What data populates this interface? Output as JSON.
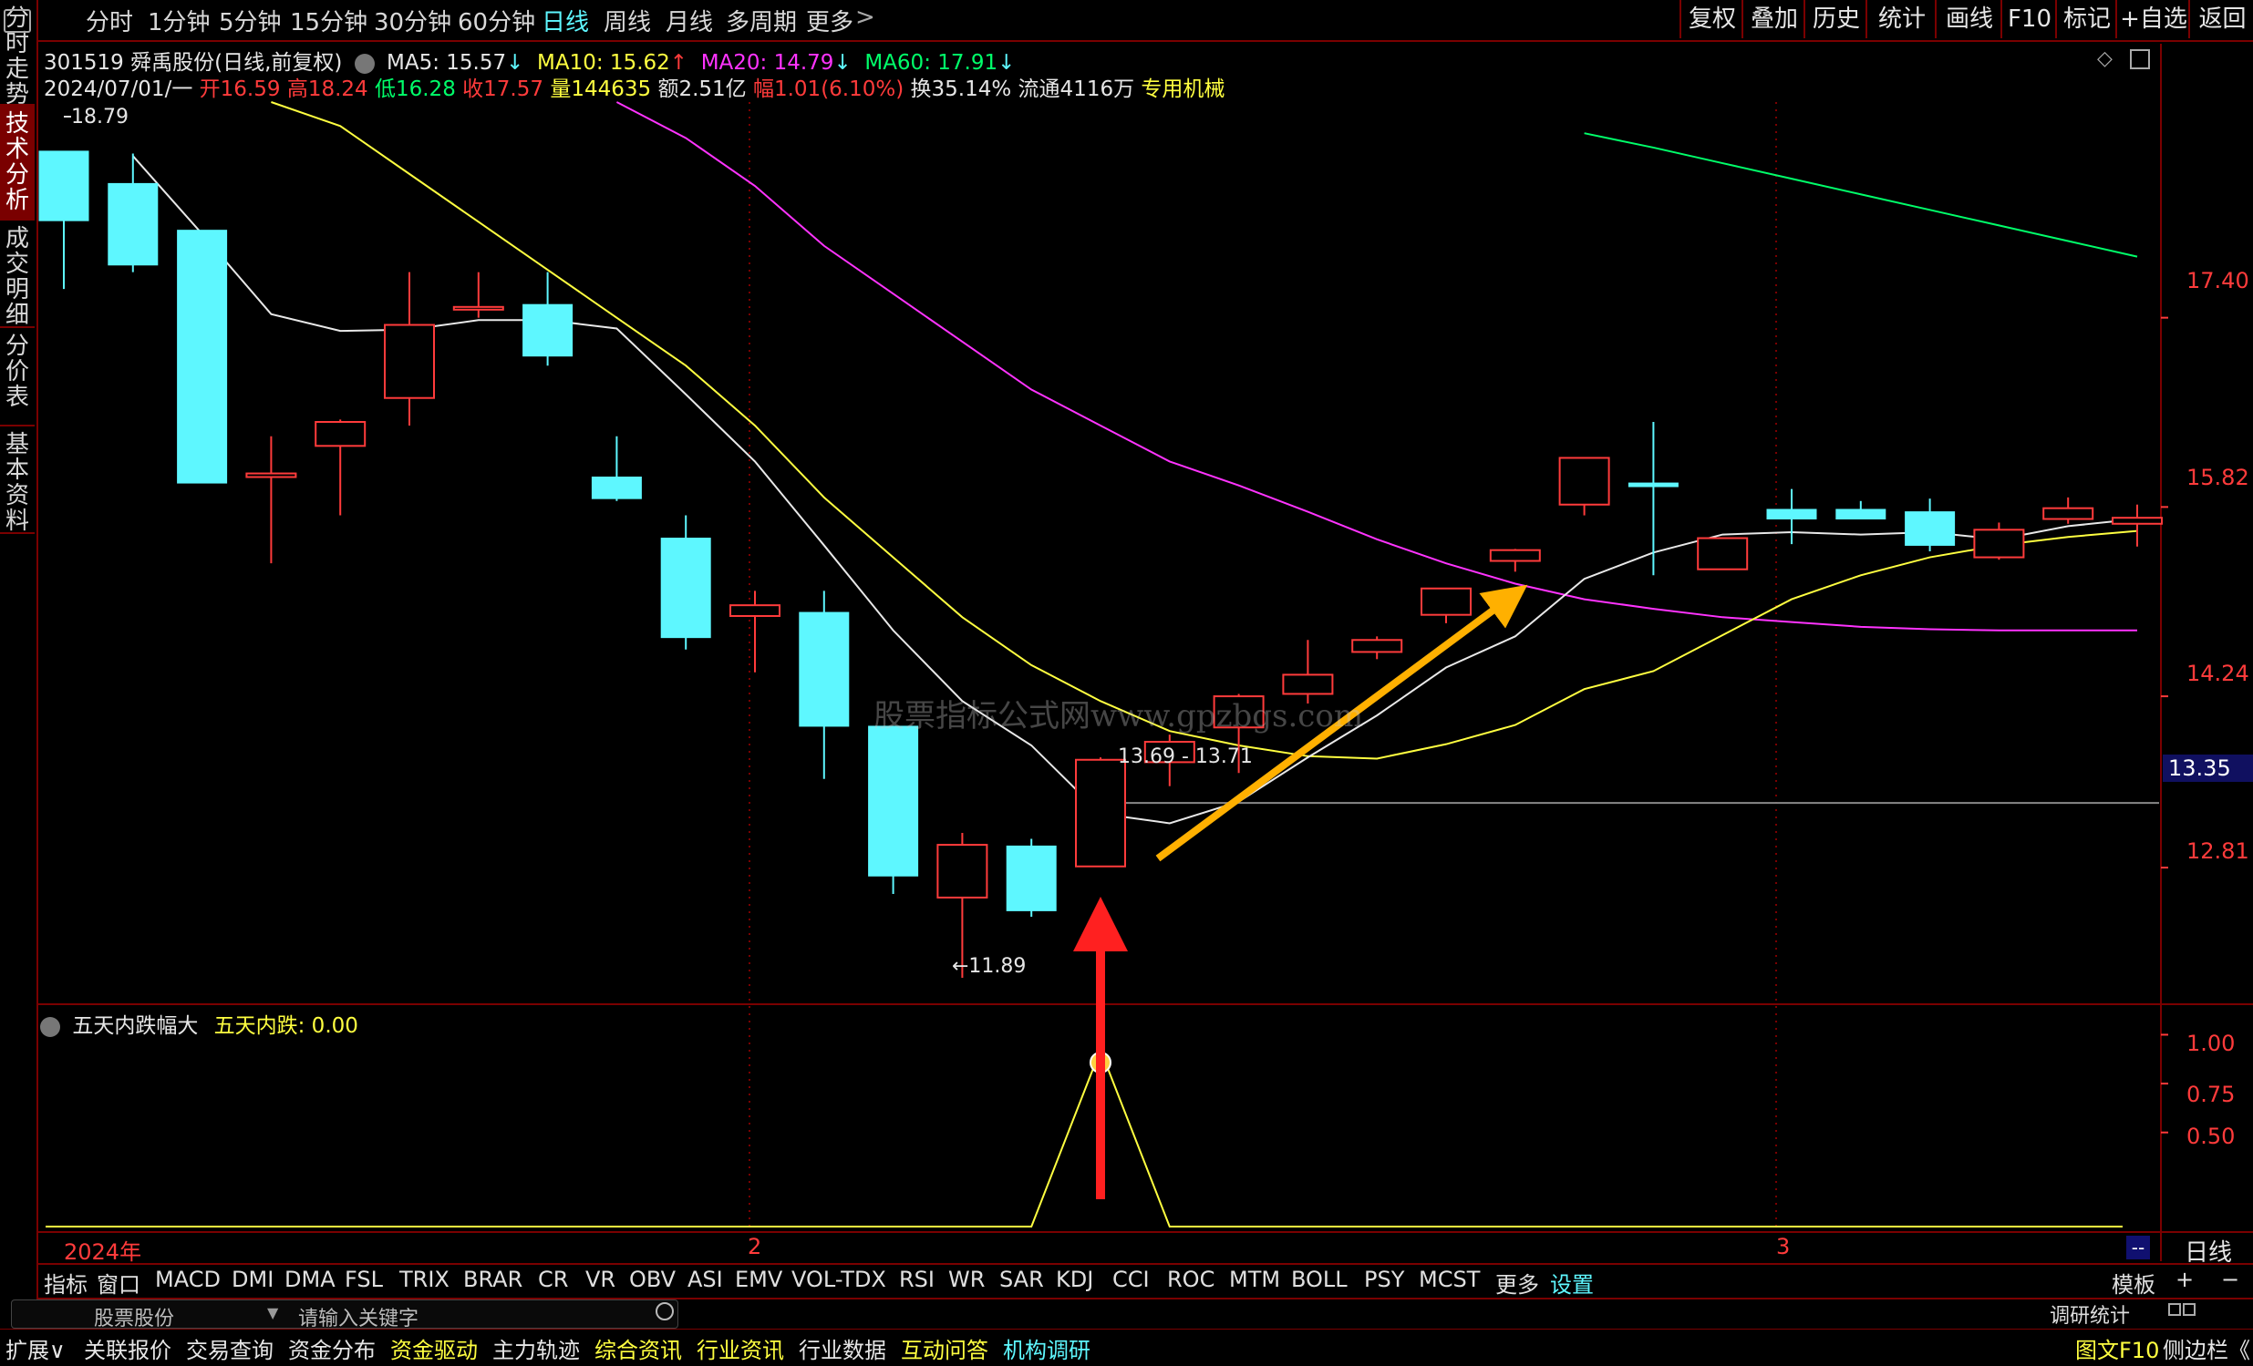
{
  "left_rail": [
    "分时走势",
    "技术分析",
    "成交明细",
    "分价表",
    "基本资料"
  ],
  "top_tabs": [
    "分时",
    "1分钟",
    "5分钟",
    "15分钟",
    "30分钟",
    "60分钟",
    "日线",
    "周线",
    "月线",
    "多周期",
    "更多"
  ],
  "top_tabs_more_arrow": ">",
  "top_right_buttons": [
    "复权",
    "叠加",
    "历史",
    "统计",
    "画线",
    "F10",
    "标记",
    "+自选",
    "返回"
  ],
  "stock_header": {
    "code_name": "301519 舜禹股份(日线,前复权)",
    "ma5": "MA5: 15.57",
    "ma10": "MA10: 15.62",
    "ma20": "MA20: 14.79",
    "ma60": "MA60: 17.91",
    "ma5_arrow": "↓",
    "ma10_arrow": "↑",
    "ma20_arrow": "↓",
    "ma60_arrow": "↓"
  },
  "quote_line": {
    "date": "2024/07/01/一",
    "open": "开16.59",
    "high": "高18.24",
    "low": "低16.28",
    "close": "收17.57",
    "volume": "量144635",
    "amount": "额2.51亿",
    "change": "幅1.01(6.10%)",
    "turnover": "换35.14%",
    "float": "流通4116万",
    "industry": "专用机械"
  },
  "price_axis": [
    "17.40",
    "15.82",
    "14.24",
    "12.81"
  ],
  "current_price_tag": "13.35",
  "annotations": {
    "high_marker": "18.79",
    "low_marker": "←11.89",
    "range_label": "13.69 - 13.71",
    "watermark": "股票指标公式网www.gpzbgs.com"
  },
  "indicator_header": {
    "name": "五天内跌幅大",
    "label": "五天内跌: 0.00"
  },
  "indicator_axis": [
    "1.00",
    "0.75",
    "0.50"
  ],
  "time_axis": {
    "year": "2024年",
    "m2": "2",
    "m3": "3"
  },
  "period_label": "日线",
  "dash_label": "--",
  "indicator_tabs": [
    "指标",
    "窗口",
    "MACD",
    "DMI",
    "DMA",
    "FSL",
    "TRIX",
    "BRAR",
    "CR",
    "VR",
    "OBV",
    "ASI",
    "EMV",
    "VOL-TDX",
    "RSI",
    "WR",
    "SAR",
    "KDJ",
    "CCI",
    "ROC",
    "MTM",
    "BOLL",
    "PSY",
    "MCST",
    "更多",
    "设置"
  ],
  "template_button": "模板",
  "plus": "+",
  "minus": "−",
  "search_row": {
    "stock_label": "股票股份",
    "placeholder": "请输入关键字",
    "right_label": "调研统计"
  },
  "bottom_tabs": [
    "扩展∨",
    "关联报价",
    "交易查询",
    "资金分布",
    "资金驱动",
    "主力轨迹",
    "综合资讯",
    "行业资讯",
    "行业数据",
    "互动问答",
    "机构调研"
  ],
  "bottom_right": [
    "图文F10",
    "侧边栏《"
  ],
  "chart_data": {
    "type": "candlestick",
    "colors": {
      "up": "#ff3b3b",
      "down": "#5ef7ff",
      "ma5": "#e8e8e8",
      "ma10": "#ffff40",
      "ma20": "#ff33ff",
      "ma60": "#00ff6a"
    },
    "ylim": [
      11.7,
      19.2
    ],
    "candles": [
      {
        "o": 18.79,
        "h": 18.79,
        "l": 17.64,
        "c": 18.21
      },
      {
        "o": 18.52,
        "h": 18.77,
        "l": 17.78,
        "c": 17.84
      },
      {
        "o": 18.13,
        "h": 18.13,
        "l": 16.07,
        "c": 16.02
      },
      {
        "o": 16.07,
        "h": 16.41,
        "l": 15.35,
        "c": 16.1
      },
      {
        "o": 16.33,
        "h": 16.55,
        "l": 15.75,
        "c": 16.53
      },
      {
        "o": 16.73,
        "h": 17.78,
        "l": 16.5,
        "c": 17.34
      },
      {
        "o": 17.47,
        "h": 17.78,
        "l": 17.4,
        "c": 17.49
      },
      {
        "o": 17.51,
        "h": 17.78,
        "l": 17.0,
        "c": 17.08
      },
      {
        "o": 16.07,
        "h": 16.41,
        "l": 15.87,
        "c": 15.89
      },
      {
        "o": 15.56,
        "h": 15.75,
        "l": 14.63,
        "c": 14.73
      },
      {
        "o": 14.91,
        "h": 15.12,
        "l": 14.44,
        "c": 15.0
      },
      {
        "o": 14.94,
        "h": 15.12,
        "l": 13.55,
        "c": 13.99
      },
      {
        "o": 13.99,
        "h": 13.99,
        "l": 12.59,
        "c": 12.74
      },
      {
        "o": 12.56,
        "h": 13.1,
        "l": 11.89,
        "c": 13.0
      },
      {
        "o": 12.99,
        "h": 13.05,
        "l": 12.4,
        "c": 12.45
      },
      {
        "o": 12.82,
        "h": 13.73,
        "l": 12.82,
        "c": 13.71
      },
      {
        "o": 13.69,
        "h": 13.92,
        "l": 13.49,
        "c": 13.86
      },
      {
        "o": 13.98,
        "h": 14.26,
        "l": 13.6,
        "c": 14.24
      },
      {
        "o": 14.26,
        "h": 14.71,
        "l": 14.18,
        "c": 14.42
      },
      {
        "o": 14.61,
        "h": 14.74,
        "l": 14.55,
        "c": 14.71
      },
      {
        "o": 14.92,
        "h": 15.04,
        "l": 14.85,
        "c": 15.14
      },
      {
        "o": 15.37,
        "h": 15.47,
        "l": 15.28,
        "c": 15.46
      },
      {
        "o": 15.84,
        "h": 16.02,
        "l": 15.75,
        "c": 16.23
      },
      {
        "o": 16.02,
        "h": 16.53,
        "l": 15.25,
        "c": 15.99
      },
      {
        "o": 15.3,
        "h": 15.47,
        "l": 15.3,
        "c": 15.56
      },
      {
        "o": 15.8,
        "h": 15.97,
        "l": 15.51,
        "c": 15.72
      },
      {
        "o": 15.8,
        "h": 15.87,
        "l": 15.8,
        "c": 15.72
      },
      {
        "o": 15.78,
        "h": 15.89,
        "l": 15.45,
        "c": 15.5
      },
      {
        "o": 15.4,
        "h": 15.69,
        "l": 15.38,
        "c": 15.63
      },
      {
        "o": 15.72,
        "h": 15.9,
        "l": 15.68,
        "c": 15.81
      },
      {
        "o": 15.68,
        "h": 15.84,
        "l": 15.49,
        "c": 15.73
      }
    ],
    "ma5": [
      null,
      18.75,
      18.1,
      17.43,
      17.29,
      17.3,
      17.38,
      17.38,
      17.31,
      16.76,
      16.2,
      15.5,
      14.79,
      14.2,
      13.83,
      13.26,
      13.18,
      13.36,
      13.73,
      14.08,
      14.48,
      14.74,
      15.22,
      15.44,
      15.59,
      15.61,
      15.59,
      15.61,
      15.55,
      15.66,
      15.72
    ],
    "ma10": [
      null,
      null,
      null,
      19.2,
      19.0,
      18.6,
      18.2,
      17.8,
      17.4,
      17.0,
      16.5,
      15.9,
      15.4,
      14.9,
      14.5,
      14.2,
      13.95,
      13.83,
      13.74,
      13.72,
      13.84,
      14.0,
      14.3,
      14.45,
      14.75,
      15.05,
      15.25,
      15.4,
      15.5,
      15.57,
      15.62
    ],
    "ma20": [
      null,
      null,
      null,
      null,
      null,
      null,
      null,
      null,
      19.2,
      18.9,
      18.5,
      18.0,
      17.6,
      17.2,
      16.8,
      16.5,
      16.2,
      16.0,
      15.78,
      15.55,
      15.35,
      15.18,
      15.05,
      14.97,
      14.9,
      14.86,
      14.82,
      14.8,
      14.79,
      14.79,
      14.79
    ],
    "ma60_tail": [
      18.94,
      18.82,
      18.69,
      18.56,
      18.43,
      18.3,
      18.17,
      18.04,
      17.91
    ],
    "indicator": {
      "name": "五天内跌幅大",
      "values_nonzero_index": 15,
      "value": 1.0,
      "ylim": [
        0,
        1.1
      ]
    }
  }
}
